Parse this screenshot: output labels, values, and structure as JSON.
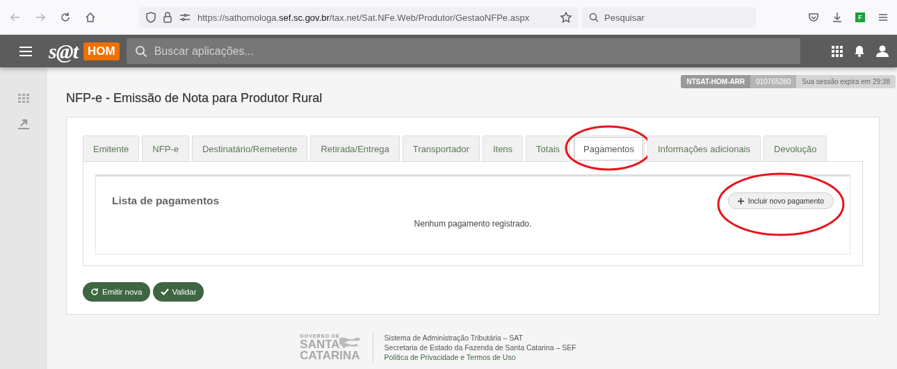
{
  "browser": {
    "url": {
      "host_start": "https://sathomologa.",
      "domain": "sef.sc.gov.br",
      "path": "/tax.net/Sat.NFe.Web/Produtor/GestaoNFPe.aspx"
    },
    "search": {
      "placeholder": "Pesquisar"
    },
    "extension_badge": "F"
  },
  "app_bar": {
    "logo": "s@t",
    "environment": "HOM",
    "search": {
      "placeholder": "Buscar aplicações..."
    }
  },
  "session": {
    "user": "NTSAT-HOM-ARR",
    "id": "010765280",
    "expiry": "Sua sessão expira em 29:38"
  },
  "page_title": "NFP-e - Emissão de Nota para Produtor Rural",
  "tabs": [
    {
      "label": "Emitente",
      "selected": false,
      "highlighted": false
    },
    {
      "label": "NFP-e",
      "selected": false,
      "highlighted": false
    },
    {
      "label": "Destinatário/Remetente",
      "selected": false,
      "highlighted": false
    },
    {
      "label": "Retirada/Entrega",
      "selected": false,
      "highlighted": false
    },
    {
      "label": "Transportador",
      "selected": false,
      "highlighted": false
    },
    {
      "label": "Itens",
      "selected": false,
      "highlighted": false
    },
    {
      "label": "Totais",
      "selected": false,
      "highlighted": false
    },
    {
      "label": "Pagamentos",
      "selected": true,
      "highlighted": true
    },
    {
      "label": "Informações adicionais",
      "selected": false,
      "highlighted": false
    },
    {
      "label": "Devolução",
      "selected": false,
      "highlighted": false
    }
  ],
  "payments": {
    "title": "Lista de pagamentos",
    "add_button": {
      "label": "Incluir novo pagamento",
      "highlighted": true
    },
    "empty_message": "Nenhum pagamento registrado."
  },
  "actions": [
    {
      "label": "Emitir nova",
      "kind": "reset"
    },
    {
      "label": "Validar",
      "kind": "check"
    }
  ],
  "footer": {
    "logo": [
      "GOVERNO DE",
      "SANTA",
      "CATARINA"
    ],
    "lines": [
      "Sistema de Administração Tributária – SAT",
      "Secretaria de Estado da Fazenda de Santa Catarina – SEF"
    ],
    "link": "Política de Privacidade e Termos de Uso"
  }
}
